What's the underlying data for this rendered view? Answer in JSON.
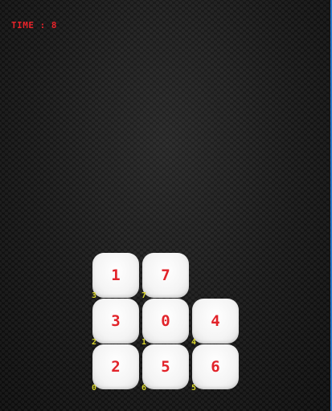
{
  "hud": {
    "time_label": "TIME :",
    "time_value": "8"
  },
  "board": {
    "tiles": [
      {
        "value": "1",
        "index_label": "3"
      },
      {
        "value": "7",
        "index_label": "7"
      },
      {
        "value": "3",
        "index_label": "2"
      },
      {
        "value": "0",
        "index_label": "1"
      },
      {
        "value": "4",
        "index_label": "4"
      },
      {
        "value": "2",
        "index_label": "0"
      },
      {
        "value": "5",
        "index_label": "6"
      },
      {
        "value": "6",
        "index_label": "5"
      }
    ]
  },
  "colors": {
    "tile_text": "#e2232a",
    "index_text": "#d9d62e",
    "hud_text": "#e8232a"
  }
}
